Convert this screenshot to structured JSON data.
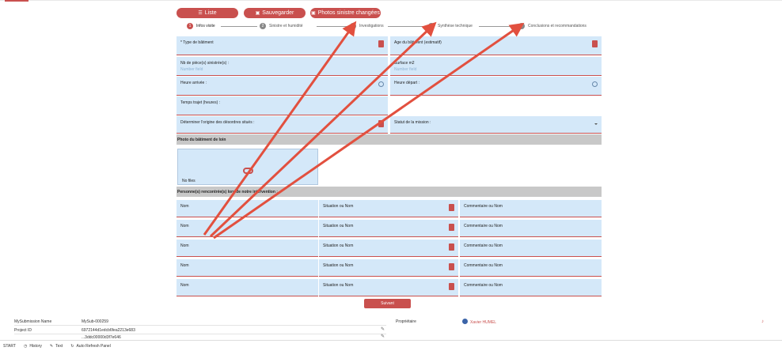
{
  "toolbar": {
    "list_label": "Liste",
    "save_label": "Sauvegarder",
    "photos_label": "Photos sinistre changées",
    "accent": "#c9504e"
  },
  "steps": [
    {
      "num": "1",
      "label": "Infos visite",
      "active": true
    },
    {
      "num": "2",
      "label": "Sinistre et humidité"
    },
    {
      "num": "3",
      "label": "Investigations"
    },
    {
      "num": "4",
      "label": "Synthèse technique"
    },
    {
      "num": "5",
      "label": "Conclusions et recommandations"
    }
  ],
  "form": {
    "type_batiment": "* Type de bâtiment",
    "age_batiment": "Age du bâtiment (estimatif)",
    "nb_pieces": "Nb de pièce(s) sinistrée(s) :",
    "number_field": "Number field",
    "surface": "Surface m2",
    "heure_arrivee": "Heure arrivée :",
    "heure_depart": "Heure départ :",
    "temps_trajet": "Temps trajet (heures) :",
    "origine": "Déterminer l'origine des désordres situés :",
    "statut": "Statut de la mission :"
  },
  "sections": {
    "photo": "Photo du bâtiment de loin",
    "no_files": "No files",
    "personnes": "Personne(s) rencontrée(s) lors de notre intervention :"
  },
  "persons": {
    "nom": "Nom",
    "situation": "Situation ou Nom",
    "commentaire": "Commentaire ou Nom"
  },
  "submit_label": "Suivant",
  "meta": {
    "mysubmission_label": "MySubmission Name",
    "mysubmission_value": "MySub-000259",
    "project_label": "Project ID",
    "project_value": "6972144d1edcb6fea2213e683",
    "third_value": "...3ddc00000d3f7e646",
    "owner_label": "Propriétaire",
    "owner_value": "Xavier HUMEL"
  },
  "footer": {
    "start": "START",
    "history": "History",
    "text": "Text",
    "refresh": "Auto Refresh Panel"
  }
}
